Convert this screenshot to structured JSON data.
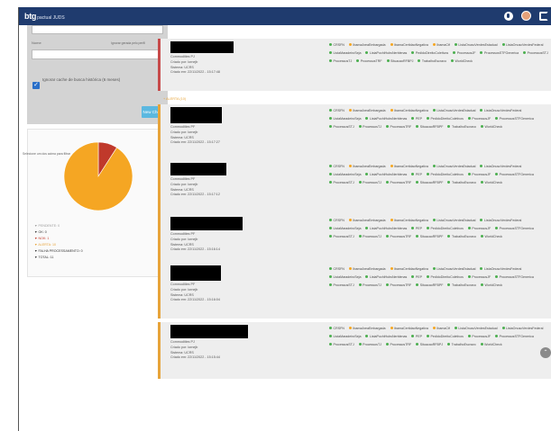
{
  "topbar": {
    "brand_bold": "btg",
    "brand_rest": "pactual JUDS",
    "icons": [
      "globe-icon",
      "avatar",
      "logout-icon"
    ],
    "color": "#1f3b6e"
  },
  "form": {
    "nome_label": "Nome",
    "hint": "Ignorar gerada pelo perfil",
    "cache_checked": true,
    "cache_label": "Ignorar cache de busca histórica (6 meses)",
    "new_check_button": "New Check"
  },
  "chart_data": {
    "type": "pie",
    "categories": [
      "PENDENTE",
      "OK",
      "NOK",
      "ALERTA",
      "FALHA PROCESSAMENTO"
    ],
    "values": [
      0,
      0,
      1,
      10,
      0
    ],
    "colors": [
      "#bdbdbd",
      "#4caf50",
      "#c0392b",
      "#f5a623",
      "#555555"
    ],
    "legend": [
      {
        "label": "PENDENTE: 0",
        "color": "#9e9e9e"
      },
      {
        "label": "OK: 0",
        "color": "#333333"
      },
      {
        "label": "NOK: 1",
        "color": "#c0392b"
      },
      {
        "label": "ALERTA: 10",
        "color": "#e7a43a"
      },
      {
        "label": "FALHA PROCESSAMENTO: 0",
        "color": "#333333"
      },
      {
        "label": "TOTAL: 11",
        "color": "#333333"
      }
    ],
    "note": "Selecione um dos acima para filtrar"
  },
  "section_label": "+ ALERTA (10)",
  "cards": [
    {
      "title": "",
      "meta": [
        "Commodities PJ",
        "Criado por: lornejb",
        "Sistema: UCRS",
        "Criado em: 22/11/2022 - 15:17:48"
      ],
      "tags": [
        {
          "t": "CRSFN",
          "c": "#4caf50"
        },
        {
          "t": "IbamaAreaEmbargada",
          "c": "#f5a623"
        },
        {
          "t": "IbamaCertidaoNegativa",
          "c": "#f5a623"
        },
        {
          "t": "IbamaCtf",
          "c": "#f5a623"
        },
        {
          "t": "ListaOnuscVerdesEstadual",
          "c": "#4caf50"
        },
        {
          "t": "ListaOnuscVerdesFederal",
          "c": "#4caf50"
        },
        {
          "t": "ListaMaradeiroSeja",
          "c": "#4caf50"
        },
        {
          "t": "ListaPochiHubsNerblenas",
          "c": "#4caf50"
        },
        {
          "t": "PedidoDireitoColetivos",
          "c": "#4caf50"
        },
        {
          "t": "ProcessosJF",
          "c": "#4caf50"
        },
        {
          "t": "ProcessosSTFGenerica",
          "c": "#4caf50"
        },
        {
          "t": "ProcessosSTJ",
          "c": "#4caf50"
        },
        {
          "t": "ProcessosTJ",
          "c": "#4caf50"
        },
        {
          "t": "ProcessosTRF",
          "c": "#4caf50"
        },
        {
          "t": "SituacaoRFBPJ",
          "c": "#4caf50"
        },
        {
          "t": "TrabalhoEscravo",
          "c": "#4caf50"
        },
        {
          "t": "WorldCheck",
          "c": "#4caf50"
        }
      ]
    },
    {
      "title": "",
      "meta": [
        "Commodities PF",
        "Criado por: lornejb",
        "Sistema: UCRS",
        "Criado em: 22/11/2022 - 15:17:27"
      ],
      "tags": [
        {
          "t": "CRSFN",
          "c": "#4caf50"
        },
        {
          "t": "IbamaAreaEmbargada",
          "c": "#f5a623"
        },
        {
          "t": "IbamaCertidaoNegativa",
          "c": "#f5a623"
        },
        {
          "t": "ListaOnuscVerdesEstadual",
          "c": "#4caf50"
        },
        {
          "t": "ListaOnuscVerdesFederal",
          "c": "#4caf50"
        },
        {
          "t": "ListaMaradeiroSeja",
          "c": "#4caf50"
        },
        {
          "t": "ListaPochiHubsNerblenas",
          "c": "#4caf50"
        },
        {
          "t": "PEP",
          "c": "#4caf50"
        },
        {
          "t": "PedidoDireitoColetivos",
          "c": "#4caf50"
        },
        {
          "t": "ProcessosJF",
          "c": "#4caf50"
        },
        {
          "t": "ProcessosSTFGenerica",
          "c": "#4caf50"
        },
        {
          "t": "ProcessosSTJ",
          "c": "#4caf50"
        },
        {
          "t": "ProcessosTJ",
          "c": "#4caf50"
        },
        {
          "t": "ProcessosTRF",
          "c": "#4caf50"
        },
        {
          "t": "SituacaoRFBPF",
          "c": "#4caf50"
        },
        {
          "t": "TrabalhoEscravo",
          "c": "#4caf50"
        },
        {
          "t": "WorldCheck",
          "c": "#4caf50"
        }
      ]
    },
    {
      "title": "",
      "meta": [
        "Commodities PF",
        "Criado por: lornejb",
        "Sistema: UCRS",
        "Criado em: 22/11/2022 - 15:17:12"
      ],
      "tags": [
        {
          "t": "CRSFN",
          "c": "#4caf50"
        },
        {
          "t": "IbamaAreaEmbargada",
          "c": "#f5a623"
        },
        {
          "t": "IbamaCertidaoNegativa",
          "c": "#f5a623"
        },
        {
          "t": "ListaOnuscVerdesEstadual",
          "c": "#4caf50"
        },
        {
          "t": "ListaOnuscVerdesFederal",
          "c": "#4caf50"
        },
        {
          "t": "ListaMaradeiroSeja",
          "c": "#4caf50"
        },
        {
          "t": "ListaPochiHubsNerblenas",
          "c": "#4caf50"
        },
        {
          "t": "PEP",
          "c": "#4caf50"
        },
        {
          "t": "PedidoDireitoColetivos",
          "c": "#4caf50"
        },
        {
          "t": "ProcessosJF",
          "c": "#4caf50"
        },
        {
          "t": "ProcessosSTFGenerica",
          "c": "#4caf50"
        },
        {
          "t": "ProcessosSTJ",
          "c": "#4caf50"
        },
        {
          "t": "ProcessosTJ",
          "c": "#4caf50"
        },
        {
          "t": "ProcessosTRF",
          "c": "#4caf50"
        },
        {
          "t": "SituacaoRFBPF",
          "c": "#4caf50"
        },
        {
          "t": "TrabalhoEscravo",
          "c": "#4caf50"
        },
        {
          "t": "WorldCheck",
          "c": "#4caf50"
        }
      ]
    },
    {
      "title": "",
      "meta": [
        "Commodities PF",
        "Criado por: lornejb",
        "Sistema: UCRS",
        "Criado em: 22/11/2022 - 15:16:14"
      ],
      "tags": [
        {
          "t": "CRSFN",
          "c": "#4caf50"
        },
        {
          "t": "IbamaAreaEmbargada",
          "c": "#f5a623"
        },
        {
          "t": "IbamaCertidaoNegativa",
          "c": "#f5a623"
        },
        {
          "t": "ListaOnuscVerdesEstadual",
          "c": "#4caf50"
        },
        {
          "t": "ListaOnuscVerdesFederal",
          "c": "#4caf50"
        },
        {
          "t": "ListaMaradeiroSeja",
          "c": "#4caf50"
        },
        {
          "t": "ListaPochiHubsNerblenas",
          "c": "#4caf50"
        },
        {
          "t": "PEP",
          "c": "#4caf50"
        },
        {
          "t": "PedidoDireitoColetivos",
          "c": "#4caf50"
        },
        {
          "t": "ProcessosJF",
          "c": "#4caf50"
        },
        {
          "t": "ProcessosSTFGenerica",
          "c": "#4caf50"
        },
        {
          "t": "ProcessosSTJ",
          "c": "#4caf50"
        },
        {
          "t": "ProcessosTJ",
          "c": "#4caf50"
        },
        {
          "t": "ProcessosTRF",
          "c": "#4caf50"
        },
        {
          "t": "SituacaoRFBPF",
          "c": "#4caf50"
        },
        {
          "t": "TrabalhoEscravo",
          "c": "#4caf50"
        },
        {
          "t": "WorldCheck",
          "c": "#4caf50"
        }
      ]
    },
    {
      "title": "",
      "meta": [
        "Commodities PF",
        "Criado por: lornejb",
        "Sistema: UCRS",
        "Criado em: 22/11/2022 - 15:16:04"
      ],
      "tags": [
        {
          "t": "CRSFN",
          "c": "#4caf50"
        },
        {
          "t": "IbamaAreaEmbargada",
          "c": "#f5a623"
        },
        {
          "t": "IbamaCertidaoNegativa",
          "c": "#f5a623"
        },
        {
          "t": "ListaOnuscVerdesEstadual",
          "c": "#4caf50"
        },
        {
          "t": "ListaOnuscVerdesFederal",
          "c": "#4caf50"
        },
        {
          "t": "ListaMaradeiroSeja",
          "c": "#4caf50"
        },
        {
          "t": "ListaPochiHubsNerblenas",
          "c": "#4caf50"
        },
        {
          "t": "PEP",
          "c": "#4caf50"
        },
        {
          "t": "PedidoDireitoColetivos",
          "c": "#4caf50"
        },
        {
          "t": "ProcessosJF",
          "c": "#4caf50"
        },
        {
          "t": "ProcessosSTFGenerica",
          "c": "#4caf50"
        },
        {
          "t": "ProcessosSTJ",
          "c": "#4caf50"
        },
        {
          "t": "ProcessosTJ",
          "c": "#4caf50"
        },
        {
          "t": "ProcessosTRF",
          "c": "#4caf50"
        },
        {
          "t": "SituacaoRFBPF",
          "c": "#4caf50"
        },
        {
          "t": "TrabalhoEscravo",
          "c": "#4caf50"
        },
        {
          "t": "WorldCheck",
          "c": "#4caf50"
        }
      ]
    },
    {
      "title": "",
      "meta": [
        "Commodities PJ",
        "Criado por: lornejb",
        "Sistema: UCRS",
        "Criado em: 22/11/2022 - 15:15:44"
      ],
      "tags": [
        {
          "t": "CRSFN",
          "c": "#4caf50"
        },
        {
          "t": "IbamaAreaEmbargada",
          "c": "#f5a623"
        },
        {
          "t": "IbamaCertidaoNegativa",
          "c": "#f5a623"
        },
        {
          "t": "IbamaCtf",
          "c": "#f5a623"
        },
        {
          "t": "ListaOnuscVerdesEstadual",
          "c": "#4caf50"
        },
        {
          "t": "ListaOnuscVerdesFederal",
          "c": "#4caf50"
        },
        {
          "t": "ListaMaradeiroSeja",
          "c": "#4caf50"
        },
        {
          "t": "ListaPochiHubsNerblenas",
          "c": "#4caf50"
        },
        {
          "t": "PEP",
          "c": "#4caf50"
        },
        {
          "t": "PedidoDireitoColetivos",
          "c": "#4caf50"
        },
        {
          "t": "ProcessosJF",
          "c": "#4caf50"
        },
        {
          "t": "ProcessosSTFGenerica",
          "c": "#4caf50"
        },
        {
          "t": "ProcessosSTJ",
          "c": "#4caf50"
        },
        {
          "t": "ProcessosTJ",
          "c": "#4caf50"
        },
        {
          "t": "ProcessosTRF",
          "c": "#4caf50"
        },
        {
          "t": "SituacaoRFBPJ",
          "c": "#4caf50"
        },
        {
          "t": "TrabalhoEscravo",
          "c": "#4caf50"
        },
        {
          "t": "WorldCheck",
          "c": "#4caf50"
        }
      ]
    }
  ]
}
